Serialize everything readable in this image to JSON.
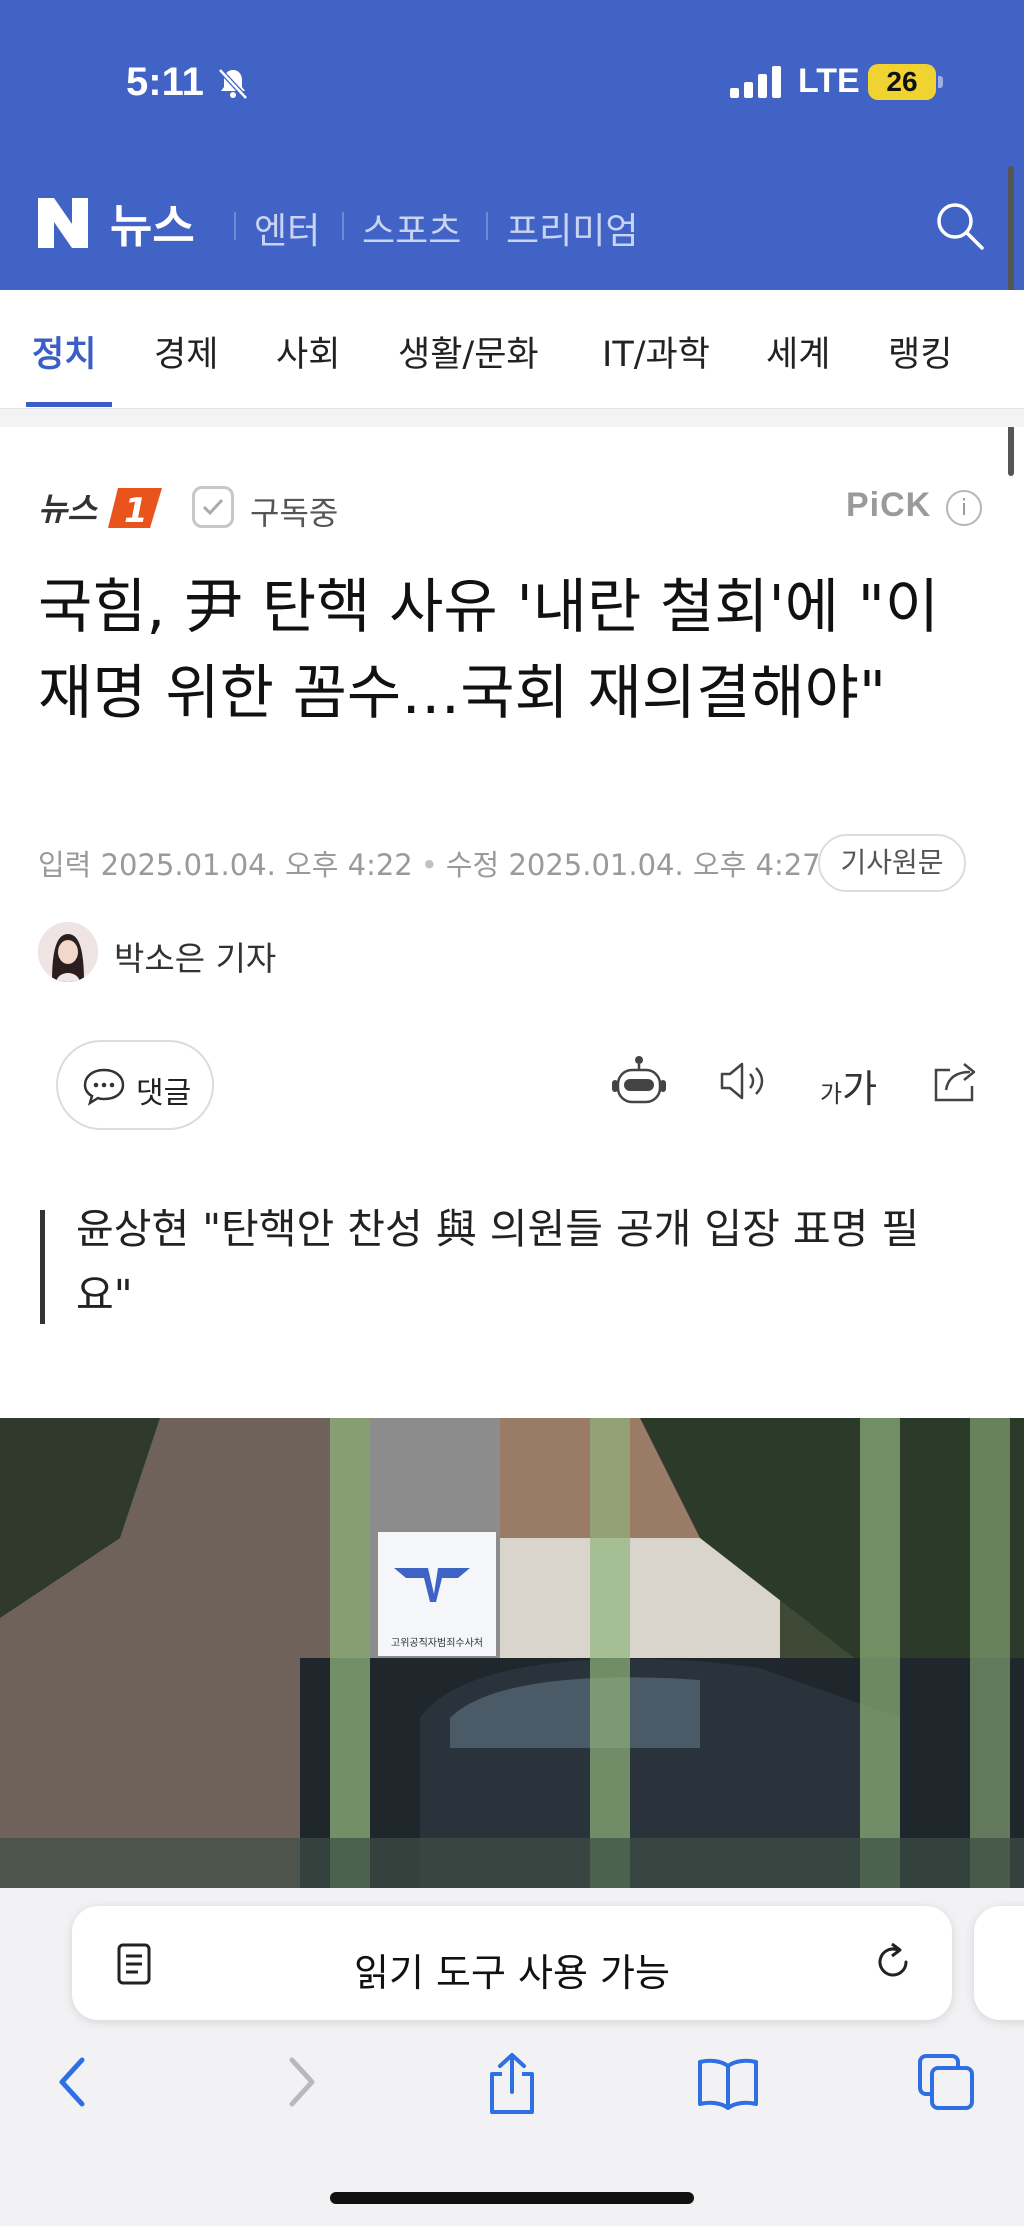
{
  "status": {
    "time": "5:11",
    "network": "LTE",
    "battery": "26"
  },
  "header": {
    "logo": "뉴스",
    "nav": [
      "엔터",
      "스포츠",
      "프리미엄"
    ],
    "colors": {
      "brand": "#4263c6"
    }
  },
  "categories": {
    "items": [
      "정치",
      "경제",
      "사회",
      "생활/문화",
      "IT/과학",
      "세계",
      "랭킹"
    ],
    "active": "정치"
  },
  "article": {
    "press": "뉴스1",
    "subscribe_label": "구독중",
    "pick": "PiCK",
    "pick_info": "i",
    "title": "국힘, 尹 탄핵 사유 '내란 철회'에 \"이재명 위한 꼼수…국회 재의결해야\"",
    "published": "입력 2025.01.04. 오후 4:22",
    "modified": "수정 2025.01.04. 오후 4:27",
    "original_button": "기사원문",
    "reporter": "박소은 기자",
    "comment_label": "댓글",
    "font_small": "가",
    "font_big": "가",
    "subheading": "윤상현 \"탄핵안 찬성 與 의원들 공개 입장 표명 필요\"",
    "photo_sign": "고위공직자범죄수사처"
  },
  "safari": {
    "url_text": "읽기 도구 사용 가능"
  }
}
